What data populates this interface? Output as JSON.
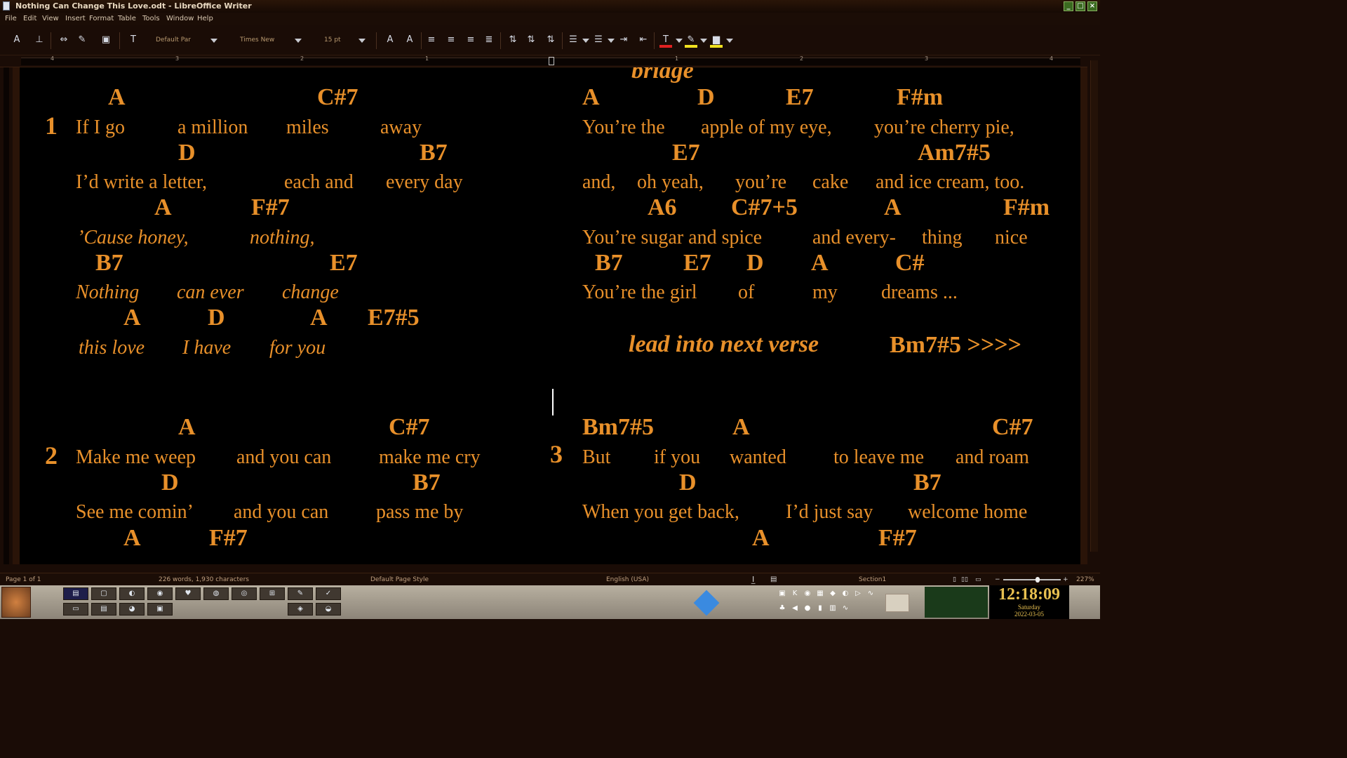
{
  "window": {
    "title": "Nothing Can Change This Love.odt - LibreOffice Writer",
    "minimize_label": "_",
    "maximize_label": "□",
    "close_label": "×"
  },
  "menu": [
    "File",
    "Edit",
    "View",
    "Insert",
    "Format",
    "Table",
    "Tools",
    "Window",
    "Help"
  ],
  "toolbar": {
    "paragraph_style": "Default Par",
    "font_name": "Times New",
    "font_size": "15 pt"
  },
  "ruler": {
    "numbers": [
      "4",
      "3",
      "2",
      "1",
      "1",
      "2",
      "3",
      "4"
    ]
  },
  "document": {
    "left": {
      "verse1_number": "1",
      "verse1": [
        {
          "chords": [
            "A",
            "C#7"
          ],
          "lyrics": [
            "If I go",
            "a million",
            "miles",
            "away"
          ],
          "italic": false
        },
        {
          "chords": [
            "D",
            "B7"
          ],
          "lyrics": [
            "I’d write a letter,",
            "each and",
            "every day"
          ],
          "italic": false
        },
        {
          "chords": [
            "A",
            "F#7"
          ],
          "lyrics": [
            "’Cause honey,",
            "nothing,"
          ],
          "italic": true
        },
        {
          "chords": [
            "B7",
            "E7"
          ],
          "lyrics": [
            "Nothing",
            "can ever",
            "change"
          ],
          "italic": true
        },
        {
          "chords": [
            "A",
            "D",
            "A",
            "E7#5"
          ],
          "lyrics": [
            "this love",
            "I have",
            "for you"
          ],
          "italic": true
        }
      ],
      "verse2_number": "2",
      "verse2": [
        {
          "chords": [
            "A",
            "C#7"
          ],
          "lyrics": [
            "Make me weep",
            "and you can",
            "make me cry"
          ],
          "italic": false
        },
        {
          "chords": [
            "D",
            "B7"
          ],
          "lyrics": [
            "See me comin’",
            "and you can",
            "pass me by"
          ],
          "italic": false
        },
        {
          "chords": [
            "A",
            "F#7"
          ],
          "lyrics": [],
          "italic": false
        }
      ]
    },
    "right": {
      "bridge_label": "bridge",
      "bridge": [
        {
          "chords": [
            "A",
            "D",
            "E7",
            "F#m"
          ],
          "lyrics": [
            "You’re the",
            "apple of my eye,",
            "you’re cherry pie,"
          ],
          "italic": false
        },
        {
          "chords": [
            "E7",
            "Am7#5"
          ],
          "lyrics": [
            "and,",
            "oh yeah,",
            "you’re",
            "cake",
            "and ice cream, too."
          ],
          "italic": false
        },
        {
          "chords": [
            "A6",
            "C#7+5",
            "A",
            "F#m"
          ],
          "lyrics": [
            "You’re sugar and spice",
            "and every-",
            "thing",
            "nice"
          ],
          "italic": false
        },
        {
          "chords": [
            "B7",
            "E7",
            "D",
            "A",
            "C#"
          ],
          "lyrics": [
            "You’re the girl",
            "of",
            "my",
            "dreams ..."
          ],
          "italic": false
        }
      ],
      "lead_text": "lead into next verse",
      "lead_chord": "Bm7#5 >>>>",
      "verse3_number": "3",
      "verse3": [
        {
          "chords": [
            "Bm7#5",
            "A",
            "C#7"
          ],
          "lyrics": [
            "But",
            "if you",
            "wanted",
            "to leave me",
            "and roam"
          ],
          "italic": false
        },
        {
          "chords": [
            "D",
            "B7"
          ],
          "lyrics": [
            "When you get back,",
            "I’d just say",
            "welcome home"
          ],
          "italic": false
        },
        {
          "chords": [
            "A",
            "F#7"
          ],
          "lyrics": [],
          "italic": false
        }
      ]
    }
  },
  "status": {
    "page": "Page 1 of 1",
    "counts": "226 words, 1,930 characters",
    "page_style": "Default Page Style",
    "language": "English (USA)",
    "section": "Section1",
    "zoom": "227%",
    "zoom_minus": "−",
    "zoom_plus": "+"
  },
  "taskbar": {
    "time": "12:18:09",
    "day": "Saturday",
    "date": "2022-03-05"
  },
  "colors": {
    "text": "#e8902a",
    "page": "#000000",
    "chrome": "#1a0c06"
  }
}
